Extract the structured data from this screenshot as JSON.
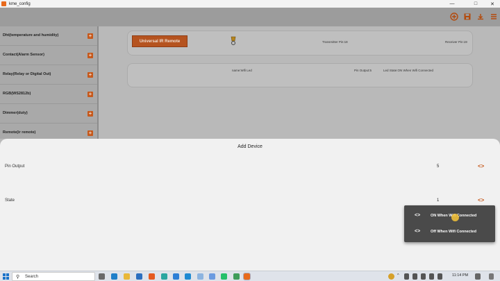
{
  "window": {
    "title": "kme_config",
    "minimize": "—",
    "maximize": "□",
    "close": "✕"
  },
  "appbar": {
    "icons": [
      "add-circle-icon",
      "save-icon",
      "download-icon",
      "menu-icon"
    ]
  },
  "sidebar": {
    "items": [
      {
        "label": "Dht(temperature and humidity)"
      },
      {
        "label": "Contact(Alarm Sensor)"
      },
      {
        "label": "Relay(Relay or Digital Out)"
      },
      {
        "label": "RGB(WS2812b)"
      },
      {
        "label": "Dimmer(duty)"
      },
      {
        "label": "Remote(ir remote)"
      }
    ]
  },
  "card1": {
    "button": "Universal IR Remote",
    "transmitter": "Transmitter Pin:18",
    "receiver": "Receiver Pin:19"
  },
  "card2": {
    "name": "name:Wifi Led",
    "pin_output": "Pin Output:5",
    "led_state": "Led State:ON When Wifi Connected"
  },
  "sheet": {
    "title": "Add Device",
    "rows": [
      {
        "label": "Pin Output",
        "value": "5"
      },
      {
        "label": "State",
        "value": "1"
      }
    ]
  },
  "popup": {
    "items": [
      {
        "label": "ON When Wifi Connected"
      },
      {
        "label": "Off When Wifi Connected"
      }
    ]
  },
  "taskbar": {
    "search_placeholder": "Search",
    "time": "11:14 PM"
  },
  "colors": {
    "accent": "#c6591c",
    "sheet_bg": "#f1f1f1",
    "popup_bg": "#4a4a4a"
  }
}
